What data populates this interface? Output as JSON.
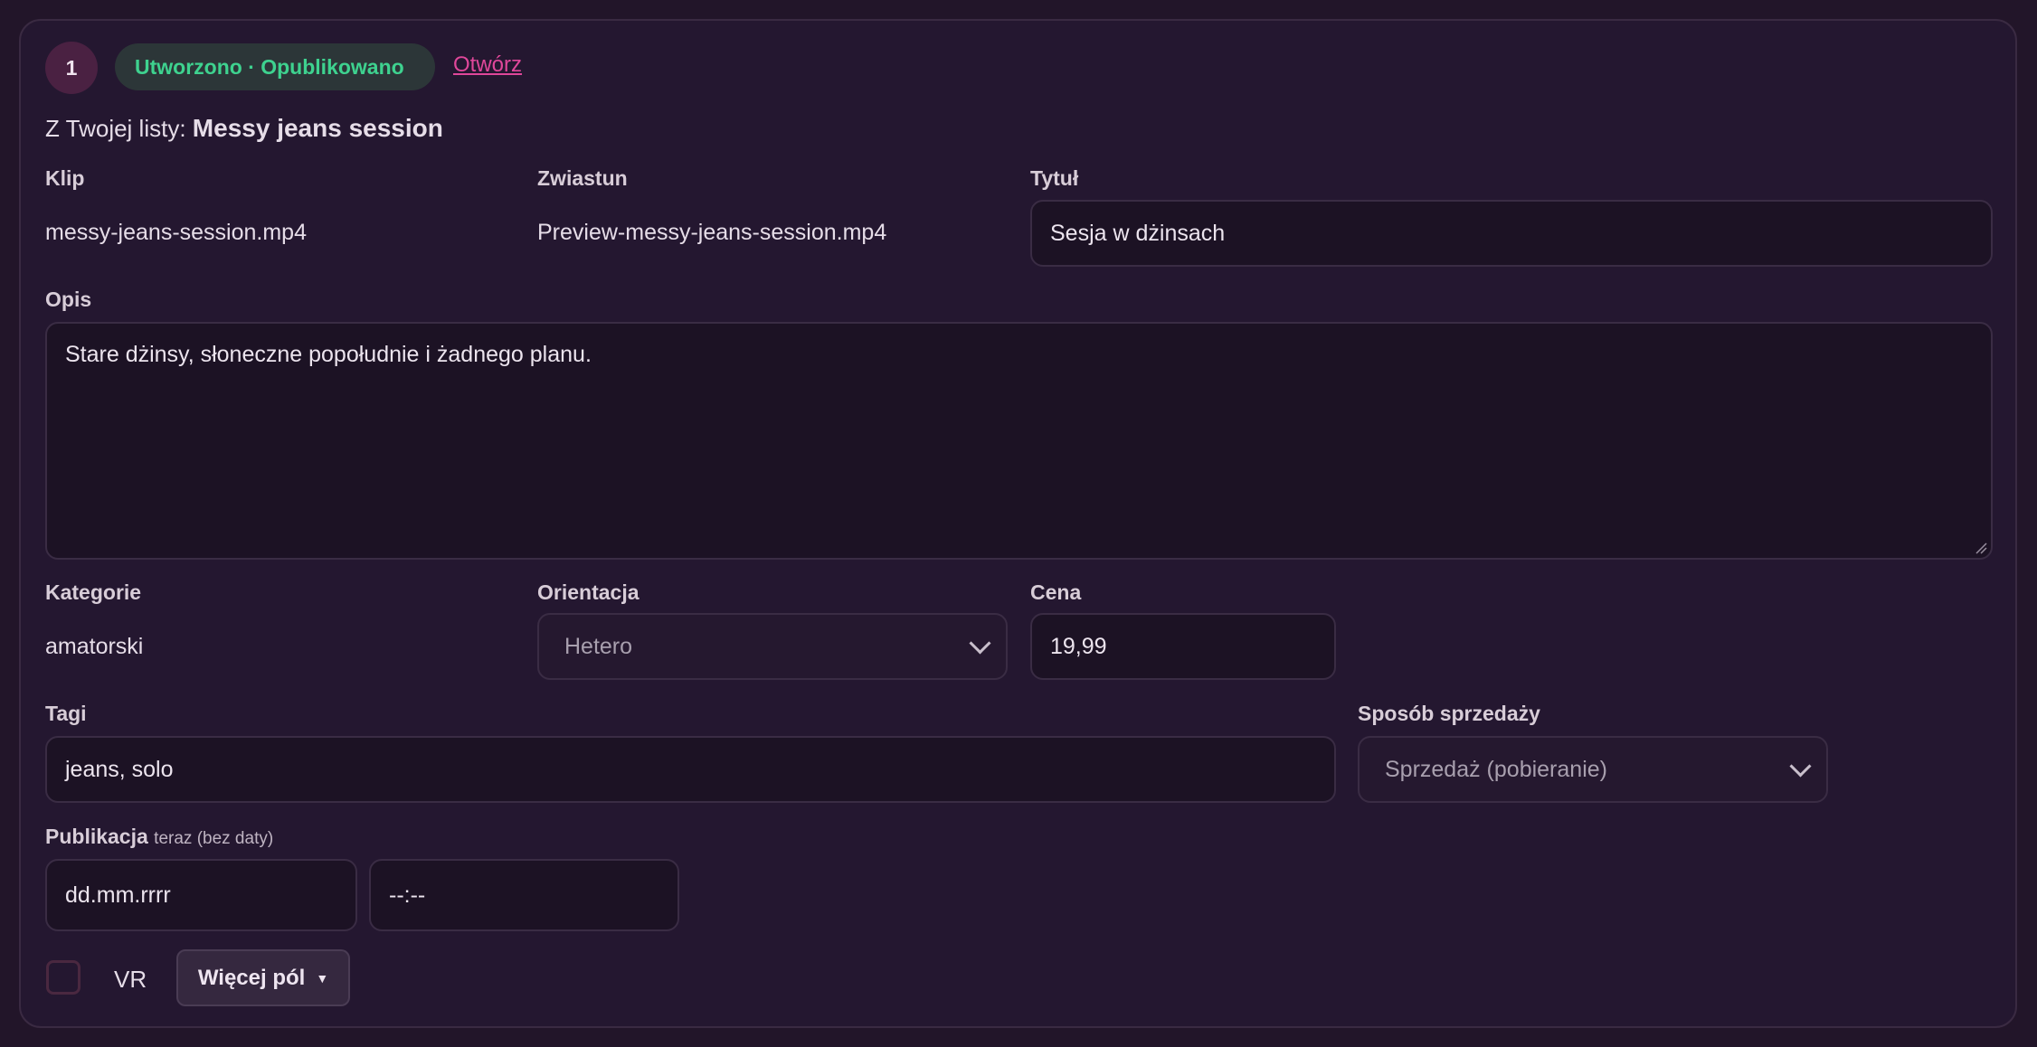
{
  "item": {
    "number": "1",
    "status": "Utworzono · Opublikowano",
    "open_link": "Otwórz",
    "from_list_prefix": "Z Twojej listy:",
    "from_list_name": "Messy jeans session"
  },
  "fields": {
    "clip_label": "Klip",
    "clip_value": "messy-jeans-session.mp4",
    "trailer_label": "Zwiastun",
    "trailer_value": "Preview-messy-jeans-session.mp4",
    "title_label": "Tytuł",
    "title_value": "Sesja w dżinsach",
    "description_label": "Opis",
    "description_value": "Stare dżinsy, słoneczne popołudnie i żadnego planu.",
    "categories_label": "Kategorie",
    "categories_value": "amatorski",
    "orientation_label": "Orientacja",
    "orientation_value": "Hetero",
    "price_label": "Cena",
    "price_value": "19,99",
    "tags_label": "Tagi",
    "tags_value": "jeans, solo",
    "sale_method_label": "Sposób sprzedaży",
    "sale_method_value": "Sprzedaż (pobieranie)",
    "publication_label": "Publikacja",
    "publication_hint": "teraz (bez daty)",
    "date_placeholder": "dd.mm.rrrr",
    "time_placeholder": "--:--"
  },
  "footer": {
    "vr_label": "VR",
    "vr_checked": false,
    "more_fields_label": "Więcej pól",
    "more_fields_caret": "▼"
  },
  "colors": {
    "background": "#221529",
    "status_text": "#3ed28f",
    "link": "#e0479a",
    "badge": "#4a2142"
  }
}
